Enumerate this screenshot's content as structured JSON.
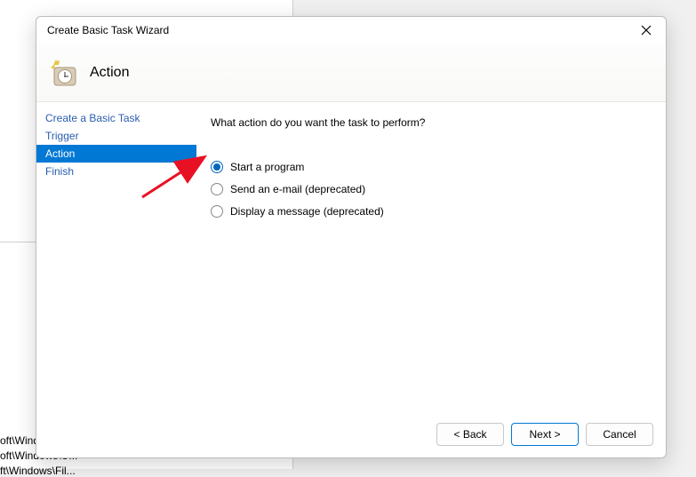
{
  "background": {
    "line1": "oft\\Windo...",
    "line2": "oft\\Windows\\U...",
    "line3": "ft\\Windows\\Fil..."
  },
  "dialog": {
    "title": "Create Basic Task Wizard",
    "header": "Action",
    "sidebar": {
      "items": [
        {
          "label": "Create a Basic Task",
          "active": false
        },
        {
          "label": "Trigger",
          "active": false
        },
        {
          "label": "Action",
          "active": true
        },
        {
          "label": "Finish",
          "active": false
        }
      ]
    },
    "content": {
      "question": "What action do you want the task to perform?",
      "options": [
        {
          "label": "Start a program",
          "selected": true
        },
        {
          "label": "Send an e-mail (deprecated)",
          "selected": false
        },
        {
          "label": "Display a message (deprecated)",
          "selected": false
        }
      ]
    },
    "footer": {
      "back": "< Back",
      "next": "Next >",
      "cancel": "Cancel"
    }
  }
}
